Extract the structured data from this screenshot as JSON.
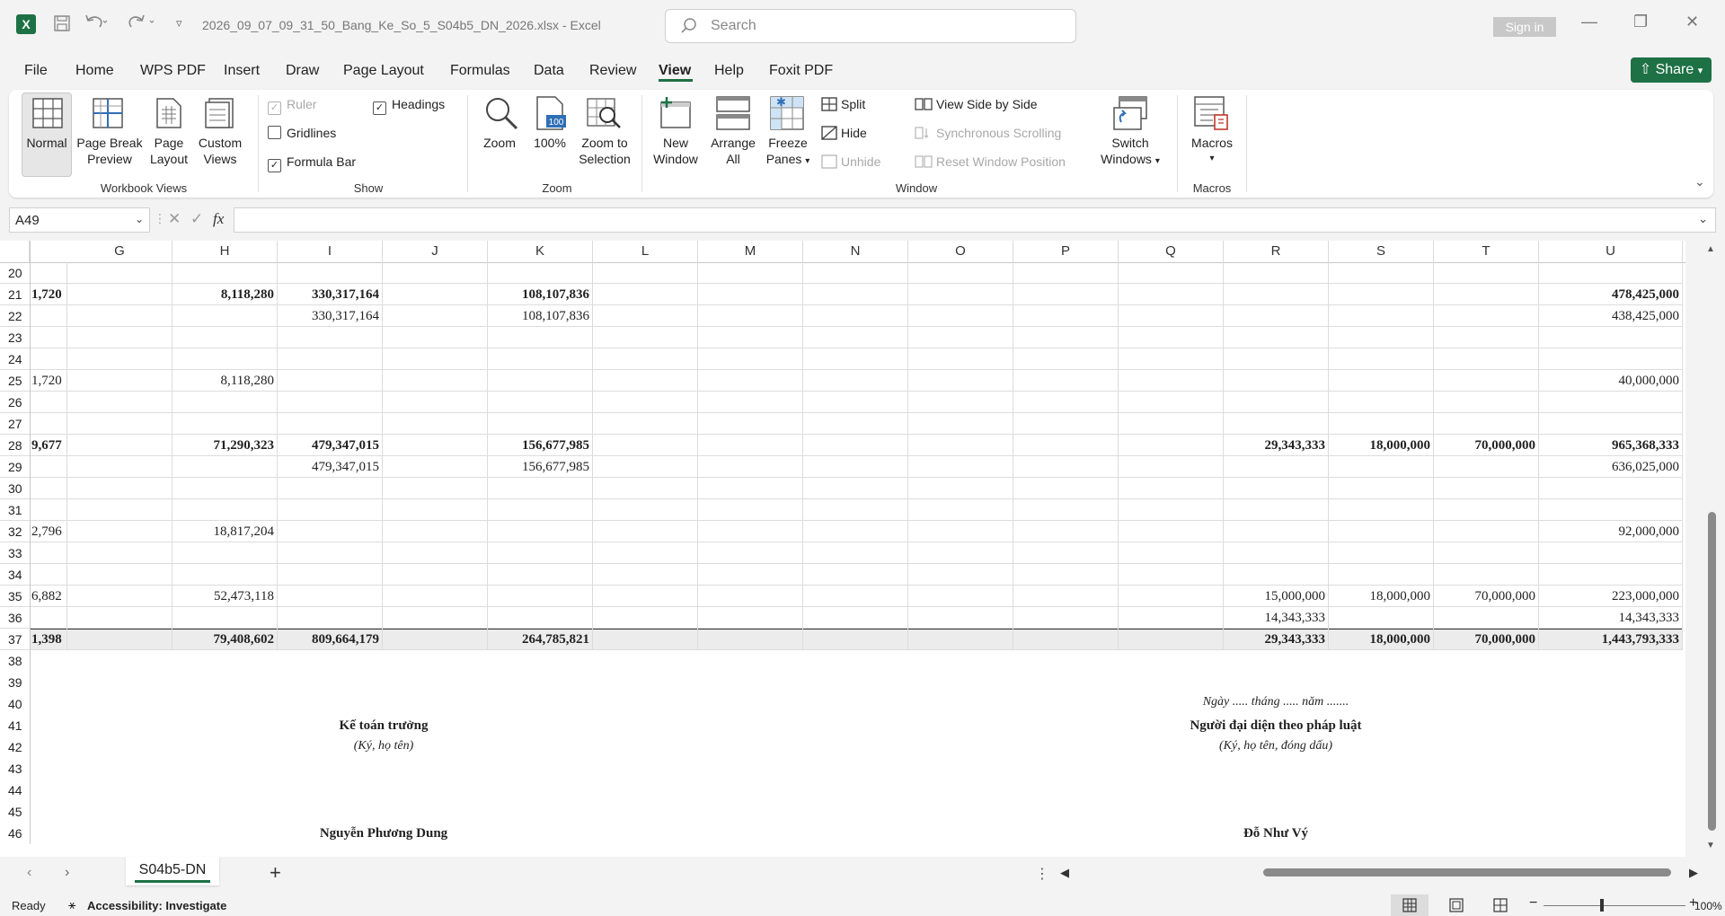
{
  "app": {
    "filename": "2026_09_07_09_31_50_Bang_Ke_So_5_S04b5_DN_2026.xlsx",
    "separator": "-",
    "app_name": "Excel",
    "search_placeholder": "Search",
    "sign_in": "Sign in",
    "share": "Share"
  },
  "menu": [
    "File",
    "Home",
    "WPS PDF",
    "Insert",
    "Draw",
    "Page Layout",
    "Formulas",
    "Data",
    "Review",
    "View",
    "Help",
    "Foxit PDF"
  ],
  "active_menu": "View",
  "ribbon": {
    "workbook_views": {
      "normal": "Normal",
      "page_break": [
        "Page Break",
        "Preview"
      ],
      "page_layout": [
        "Page",
        "Layout"
      ],
      "custom_views": [
        "Custom",
        "Views"
      ],
      "group": "Workbook Views"
    },
    "show": {
      "ruler": "Ruler",
      "gridlines": "Gridlines",
      "formula_bar": "Formula Bar",
      "headings": "Headings",
      "group": "Show"
    },
    "zoom": {
      "zoom": "Zoom",
      "hundred": "100%",
      "zoom_selection": [
        "Zoom to",
        "Selection"
      ],
      "group": "Zoom"
    },
    "window": {
      "new_window": [
        "New",
        "Window"
      ],
      "arrange_all": [
        "Arrange",
        "All"
      ],
      "freeze_panes": [
        "Freeze",
        "Panes"
      ],
      "split": "Split",
      "hide": "Hide",
      "unhide": "Unhide",
      "side_by_side": "View Side by Side",
      "sync_scroll": "Synchronous Scrolling",
      "reset_pos": "Reset Window Position",
      "switch": [
        "Switch",
        "Windows"
      ],
      "group": "Window"
    },
    "macros": {
      "macros": "Macros",
      "group": "Macros"
    }
  },
  "formula_bar": {
    "name_box": "A49",
    "fx": "fx",
    "formula": ""
  },
  "columns": [
    "G",
    "H",
    "I",
    "J",
    "K",
    "L",
    "M",
    "N",
    "O",
    "P",
    "Q",
    "R",
    "S",
    "T",
    "U"
  ],
  "rows": [
    {
      "n": "20",
      "bold": false,
      "F": "",
      "H": "",
      "I": "",
      "K": "",
      "R": "",
      "S": "",
      "T": "",
      "U": ""
    },
    {
      "n": "21",
      "bold": true,
      "F": "1,720",
      "H": "8,118,280",
      "I": "330,317,164",
      "K": "108,107,836",
      "R": "",
      "S": "",
      "T": "",
      "U": "478,425,000"
    },
    {
      "n": "22",
      "bold": false,
      "F": "",
      "H": "",
      "I": "330,317,164",
      "K": "108,107,836",
      "R": "",
      "S": "",
      "T": "",
      "U": "438,425,000"
    },
    {
      "n": "23",
      "bold": false,
      "F": "",
      "H": "",
      "I": "",
      "K": "",
      "R": "",
      "S": "",
      "T": "",
      "U": ""
    },
    {
      "n": "24",
      "bold": false,
      "F": "",
      "H": "",
      "I": "",
      "K": "",
      "R": "",
      "S": "",
      "T": "",
      "U": ""
    },
    {
      "n": "25",
      "bold": false,
      "F": "1,720",
      "H": "8,118,280",
      "I": "",
      "K": "",
      "R": "",
      "S": "",
      "T": "",
      "U": "40,000,000"
    },
    {
      "n": "26",
      "bold": false,
      "F": "",
      "H": "",
      "I": "",
      "K": "",
      "R": "",
      "S": "",
      "T": "",
      "U": ""
    },
    {
      "n": "27",
      "bold": false,
      "F": "",
      "H": "",
      "I": "",
      "K": "",
      "R": "",
      "S": "",
      "T": "",
      "U": ""
    },
    {
      "n": "28",
      "bold": true,
      "F": "9,677",
      "H": "71,290,323",
      "I": "479,347,015",
      "K": "156,677,985",
      "R": "29,343,333",
      "S": "18,000,000",
      "T": "70,000,000",
      "U": "965,368,333"
    },
    {
      "n": "29",
      "bold": false,
      "F": "",
      "H": "",
      "I": "479,347,015",
      "K": "156,677,985",
      "R": "",
      "S": "",
      "T": "",
      "U": "636,025,000"
    },
    {
      "n": "30",
      "bold": false,
      "F": "",
      "H": "",
      "I": "",
      "K": "",
      "R": "",
      "S": "",
      "T": "",
      "U": ""
    },
    {
      "n": "31",
      "bold": false,
      "F": "",
      "H": "",
      "I": "",
      "K": "",
      "R": "",
      "S": "",
      "T": "",
      "U": ""
    },
    {
      "n": "32",
      "bold": false,
      "F": "2,796",
      "H": "18,817,204",
      "I": "",
      "K": "",
      "R": "",
      "S": "",
      "T": "",
      "U": "92,000,000"
    },
    {
      "n": "33",
      "bold": false,
      "F": "",
      "H": "",
      "I": "",
      "K": "",
      "R": "",
      "S": "",
      "T": "",
      "U": ""
    },
    {
      "n": "34",
      "bold": false,
      "F": "",
      "H": "",
      "I": "",
      "K": "",
      "R": "",
      "S": "",
      "T": "",
      "U": ""
    },
    {
      "n": "35",
      "bold": false,
      "F": "6,882",
      "H": "52,473,118",
      "I": "",
      "K": "",
      "R": "15,000,000",
      "S": "18,000,000",
      "T": "70,000,000",
      "U": "223,000,000"
    },
    {
      "n": "36",
      "bold": false,
      "F": "",
      "H": "",
      "I": "",
      "K": "",
      "R": "14,343,333",
      "S": "",
      "T": "",
      "U": "14,343,333"
    },
    {
      "n": "37",
      "bold": true,
      "F": "1,398",
      "H": "79,408,602",
      "I": "809,664,179",
      "K": "264,785,821",
      "R": "29,343,333",
      "S": "18,000,000",
      "T": "70,000,000",
      "U": "1,443,793,333"
    },
    {
      "n": "38"
    },
    {
      "n": "39"
    },
    {
      "n": "40"
    },
    {
      "n": "41"
    },
    {
      "n": "42"
    },
    {
      "n": "43"
    },
    {
      "n": "44"
    },
    {
      "n": "45"
    },
    {
      "n": "46"
    }
  ],
  "signatures": {
    "date_line": "Ngày ..... tháng ..... năm .......",
    "accountant_title": "Kế toán trưởng",
    "accountant_note": "(Ký, họ tên)",
    "rep_title": "Người đại diện theo pháp luật",
    "rep_note": "(Ký, họ tên, đóng dấu)",
    "accountant_name": "Nguyễn Phương Dung",
    "rep_name": "Đỗ Như Vý"
  },
  "sheet_tab": "S04b5-DN",
  "status": {
    "ready": "Ready",
    "accessibility": "Accessibility: Investigate",
    "zoom": "100%"
  },
  "colors": {
    "accent": "#1e7145",
    "header_gray": "#f3f3f3"
  }
}
